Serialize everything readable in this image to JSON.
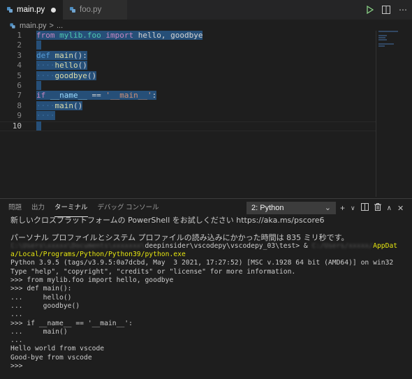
{
  "tabs": [
    {
      "label": "main.py",
      "active": true,
      "dirty": true
    },
    {
      "label": "foo.py",
      "active": false,
      "dirty": false
    }
  ],
  "editor_actions": [
    {
      "name": "run-icon",
      "glyph": "▷"
    },
    {
      "name": "split-editor-icon",
      "glyph": "◫"
    },
    {
      "name": "more-actions-icon",
      "glyph": "⋯"
    }
  ],
  "breadcrumb": {
    "file": "main.py",
    "sep": ">",
    "more": "..."
  },
  "line_numbers": [
    "1",
    "2",
    "3",
    "4",
    "5",
    "6",
    "7",
    "8",
    "9",
    "10"
  ],
  "code": {
    "l1": {
      "from": "from",
      "mod": "mylib.foo",
      "import": "import",
      "names": "hello, goodbye"
    },
    "l3": {
      "def": "def",
      "fn": "main",
      "rest": "():"
    },
    "l4": {
      "fn": "hello",
      "rest": "()"
    },
    "l5": {
      "fn": "goodbye",
      "rest": "()"
    },
    "l7": {
      "if": "if",
      "name": "__name__",
      "op": "==",
      "str": "'__main__'",
      "colon": ":"
    },
    "l8": {
      "fn": "main",
      "rest": "()"
    }
  },
  "panel": {
    "tabs": [
      "問題",
      "出力",
      "ターミナル",
      "デバッグ コンソール"
    ],
    "active_tab": "ターミナル",
    "terminal_select": "2: Python",
    "actions": [
      {
        "name": "new-terminal-icon",
        "glyph": "+"
      },
      {
        "name": "new-terminal-dropdown-icon",
        "glyph": "∨"
      },
      {
        "name": "split-terminal-icon",
        "glyph": "◫"
      },
      {
        "name": "kill-terminal-icon",
        "glyph": "🗑"
      },
      {
        "name": "maximize-panel-icon",
        "glyph": "∧"
      },
      {
        "name": "close-panel-icon",
        "glyph": "✕"
      }
    ]
  },
  "terminal": {
    "l1": "新しいクロスプラットフォームの PowerShell をお試しください https://aka.ms/pscore6",
    "l2": "",
    "l3": "パーソナル プロファイルとシステム プロファイルの読み込みにかかった時間は 835 ミリ秒です。",
    "l4_blur": "C:\\Users\\xxxxx\\Documents\\xxxxxxx\\",
    "l4_path": "deepinsider\\vscodepy\\vscodepy_03\\test> & ",
    "l4_blur2": "C:/Users/xxxxx/",
    "l4_yellow": "AppDat",
    "l5": "a/Local/Programs/Python/Python39/python.exe",
    "l6": "Python 3.9.5 (tags/v3.9.5:0a7dcbd, May  3 2021, 17:27:52) [MSC v.1928 64 bit (AMD64)] on win32",
    "l7": "Type \"help\", \"copyright\", \"credits\" or \"license\" for more information.",
    "l8": ">>> from mylib.foo import hello, goodbye",
    "l9": ">>> def main():",
    "l10": "...     hello()",
    "l11": "...     goodbye()",
    "l12": "...",
    "l13": ">>> if __name__ == '__main__':",
    "l14": "...     main()",
    "l15": "...",
    "l16": "Hello world from vscode",
    "l17": "Good-bye from vscode",
    "l18": ">>>"
  }
}
